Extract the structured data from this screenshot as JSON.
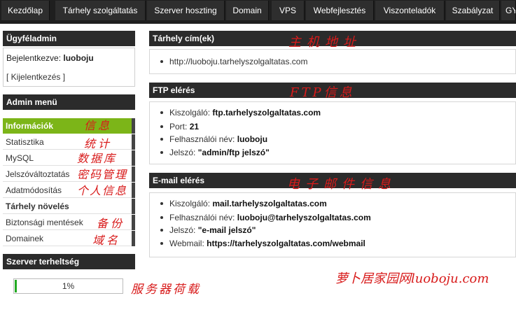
{
  "nav": {
    "tabs": [
      "Kezdőlap",
      "Tárhely szolgáltatás",
      "Szerver hoszting",
      "Domain",
      "VPS",
      "Webfejlesztés",
      "Viszonteladók",
      "Szabályzat",
      "GY"
    ]
  },
  "sidebar": {
    "client_title": "Ügyféladmin",
    "logged_in_label": "Bejelentkezve:",
    "username": "luoboju",
    "logout_label": "[ Kijelentkezés ]",
    "admin_menu_title": "Admin menü",
    "menu_items": [
      {
        "label": "Információk",
        "active": true,
        "bold": false
      },
      {
        "label": "Statisztika",
        "active": false,
        "bold": false
      },
      {
        "label": "MySQL",
        "active": false,
        "bold": false
      },
      {
        "label": "Jelszóváltoztatás",
        "active": false,
        "bold": false
      },
      {
        "label": "Adatmódosítás",
        "active": false,
        "bold": false
      },
      {
        "label": "Tárhely növelés",
        "active": false,
        "bold": true
      },
      {
        "label": "Biztonsági mentések",
        "active": false,
        "bold": false
      },
      {
        "label": "Domainek",
        "active": false,
        "bold": false
      }
    ],
    "server_load_title": "Szerver terheltség",
    "server_load_value": "1%",
    "server_load_fraction": 0.01
  },
  "main": {
    "hosting_title": "Tárhely cím(ek)",
    "hosting_url": "http://luoboju.tarhelyszolgaltatas.com",
    "ftp_title": "FTP elérés",
    "ftp": {
      "server_label": "Kiszolgáló:",
      "server_value": "ftp.tarhelyszolgaltatas.com",
      "port_label": "Port:",
      "port_value": "21",
      "user_label": "Felhasználói név:",
      "user_value": "luoboju",
      "pass_label": "Jelszó:",
      "pass_value": "\"admin/ftp jelszó\""
    },
    "email_title": "E-mail elérés",
    "email": {
      "server_label": "Kiszolgáló:",
      "server_value": "mail.tarhelyszolgaltatas.com",
      "user_label": "Felhasználói név:",
      "user_value": "luoboju@tarhelyszolgaltatas.com",
      "pass_label": "Jelszó:",
      "pass_value": "\"e-mail jelszó\"",
      "webmail_label": "Webmail:",
      "webmail_value": "https://tarhelyszolgaltatas.com/webmail"
    }
  },
  "annotations": {
    "hosting": "主机地址",
    "ftp": "FTP信息",
    "email": "电子邮件信息",
    "info": "信息",
    "stats": "统计",
    "mysql": "数据库",
    "password": "密码管理",
    "profile": "个人信息",
    "backup": "备份",
    "domains": "域名",
    "server_load": "服务器荷载",
    "watermark": "萝卜居家园网luoboju.com"
  },
  "colors": {
    "active_menu": "#7cb518",
    "progress": "#22aa22",
    "annotation": "#d81b1b",
    "header_bg": "#2b2b2b"
  }
}
